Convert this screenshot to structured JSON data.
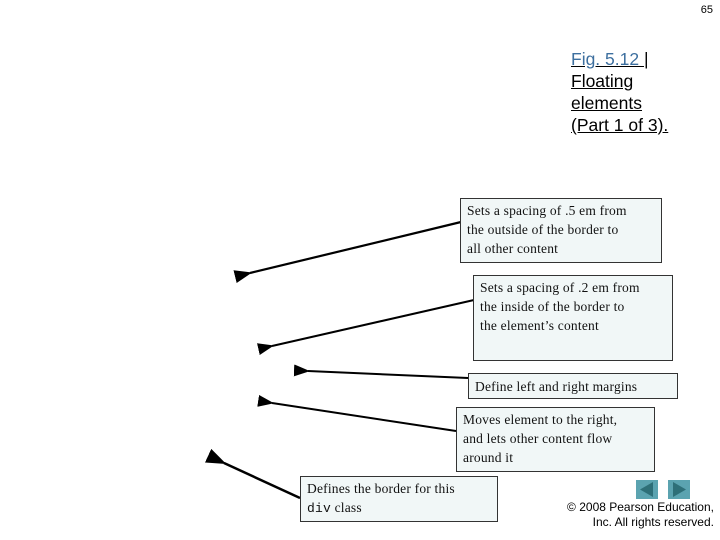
{
  "page_number": "65",
  "figure": {
    "link_text": "Fig. 5.12 ",
    "separator": "|",
    "title_lines": [
      "Floating",
      "elements",
      "(Part 1 of 3)."
    ]
  },
  "callouts": [
    {
      "lines": [
        "Sets a spacing of .5 em from",
        "the outside of the border to",
        "all other content"
      ]
    },
    {
      "lines": [
        "Sets a spacing of .2 em from",
        "the inside of the border to",
        "the element’s content"
      ]
    },
    {
      "lines": [
        "Define left and right margins"
      ]
    },
    {
      "lines": [
        "Moves element to the right,",
        "and lets other content flow",
        "around it"
      ]
    },
    {
      "line1": "Defines the border for this",
      "code": "div",
      "line2_rest": " class"
    }
  ],
  "navigation": {
    "prev_icon": "triangle-left",
    "next_icon": "triangle-right",
    "button_color": "#5ba3b0",
    "arrow_color": "#2e6f78"
  },
  "copyright": {
    "line1": "© 2008 Pearson Education,",
    "line2": "Inc.  All rights reserved."
  }
}
